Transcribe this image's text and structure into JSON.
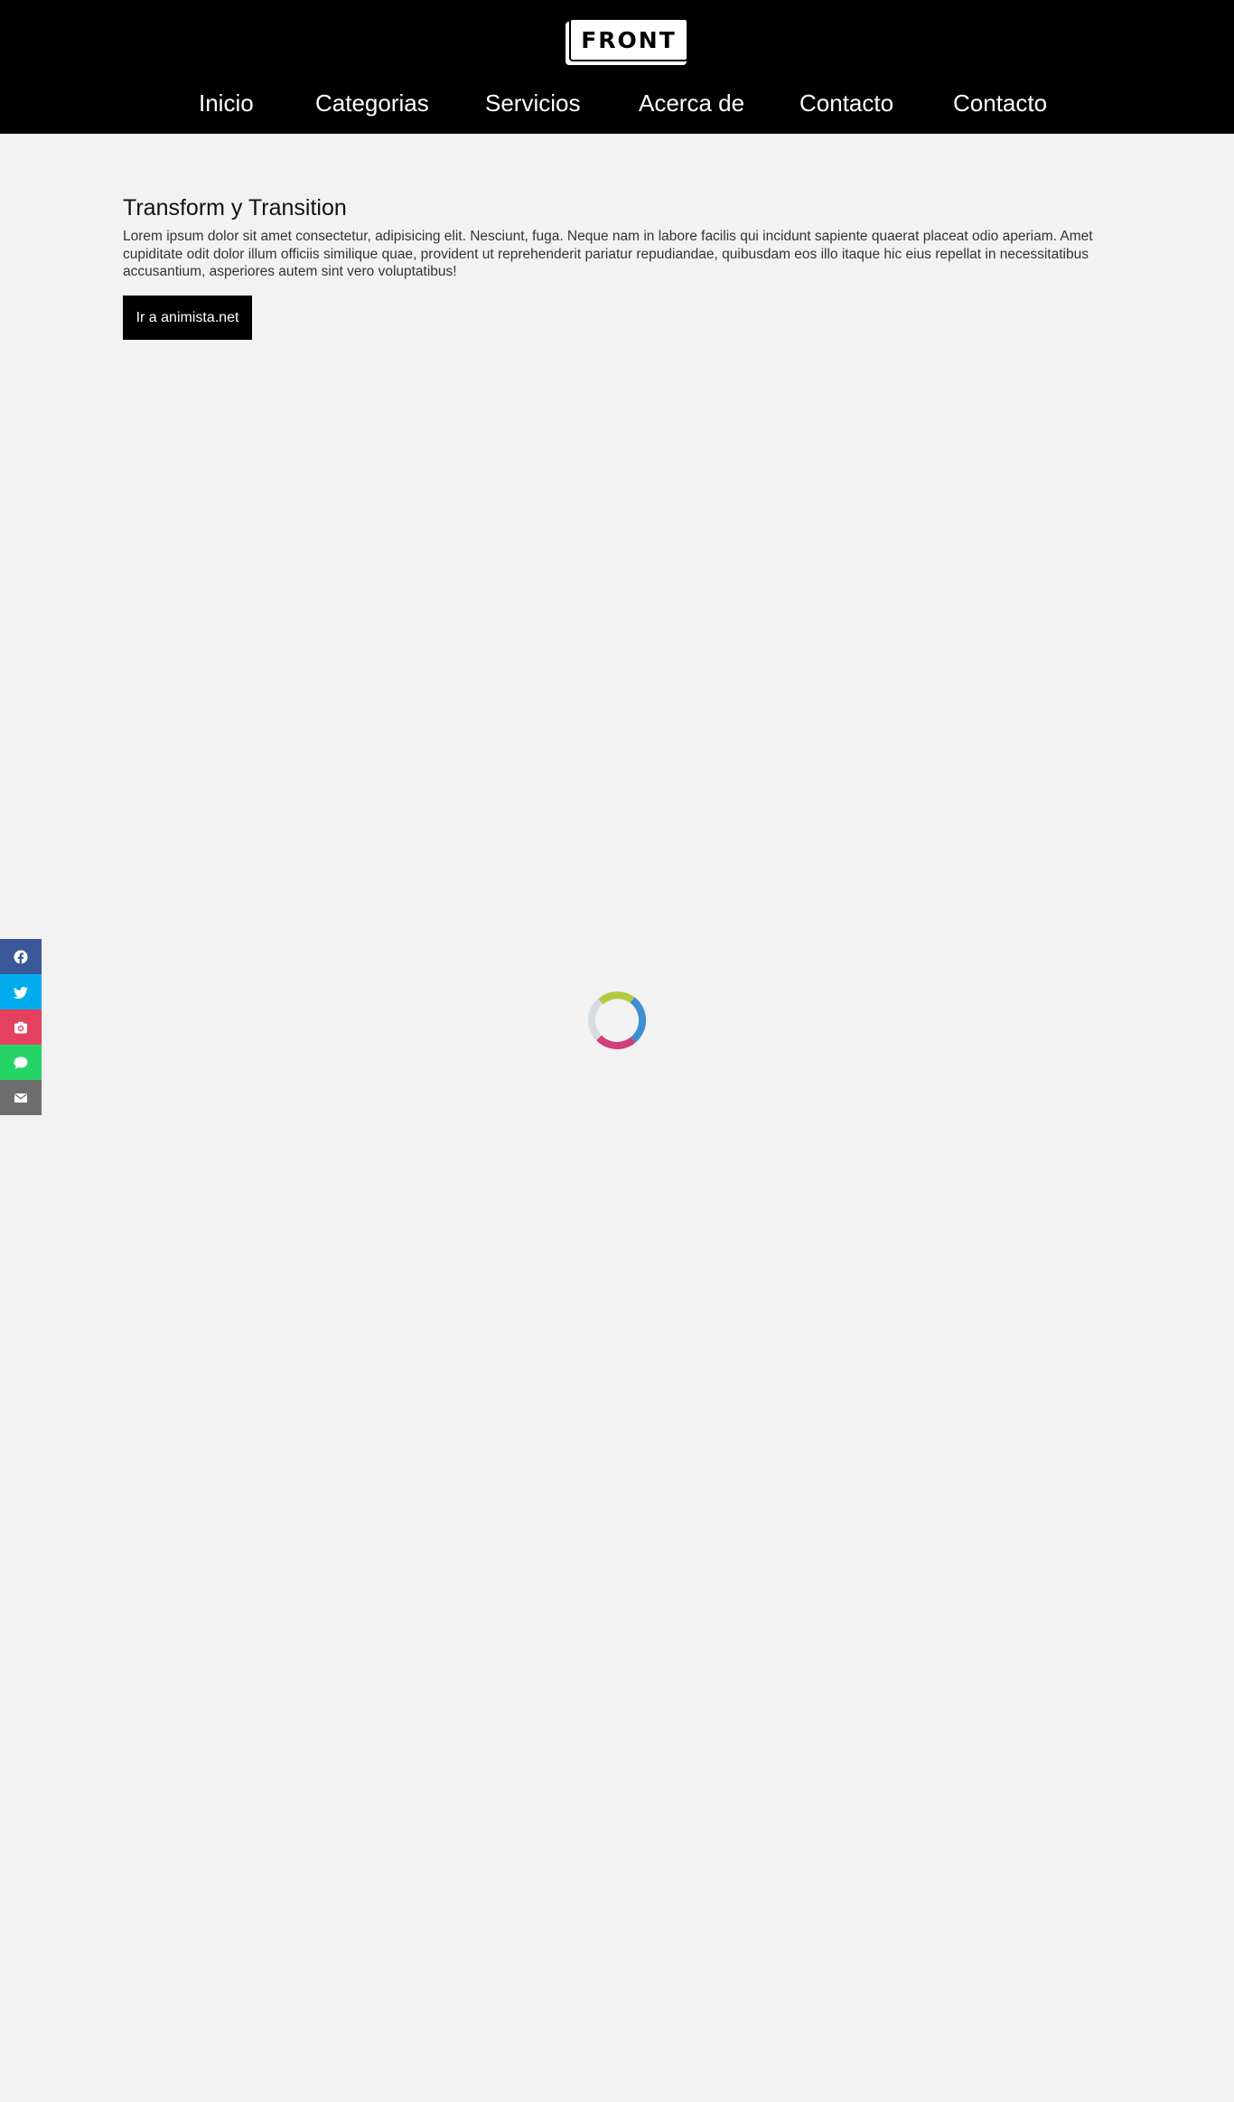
{
  "header": {
    "logo_text": "FRONT",
    "nav": [
      {
        "label": "Inicio"
      },
      {
        "label": "Categorias"
      },
      {
        "label": "Servicios"
      },
      {
        "label": "Acerca de"
      },
      {
        "label": "Contacto"
      },
      {
        "label": "Contacto"
      }
    ]
  },
  "main": {
    "title": "Transform y Transition",
    "paragraph": "Lorem ipsum dolor sit amet consectetur, adipisicing elit. Nesciunt, fuga. Neque nam in labore facilis qui incidunt sapiente quaerat placeat odio aperiam. Amet cupiditate odit dolor illum officiis similique quae, provident ut reprehenderit pariatur repudiandae, quibusdam eos illo itaque hic eius repellat in necessitatibus accusantium, asperiores autem sint vero voluptatibus!",
    "button_label": "Ir a animista.net"
  },
  "social": [
    {
      "icon": "facebook-icon",
      "color": "#3b5998"
    },
    {
      "icon": "twitter-icon",
      "color": "#00acee"
    },
    {
      "icon": "instagram-icon",
      "color": "#e4405f"
    },
    {
      "icon": "whatsapp-icon",
      "color": "#25d366"
    },
    {
      "icon": "email-icon",
      "color": "#6d6d6d"
    }
  ],
  "spinner": {
    "colors": [
      "#b5c93f",
      "#3f8fd2",
      "#d23f7c",
      "#d5dde3"
    ]
  }
}
